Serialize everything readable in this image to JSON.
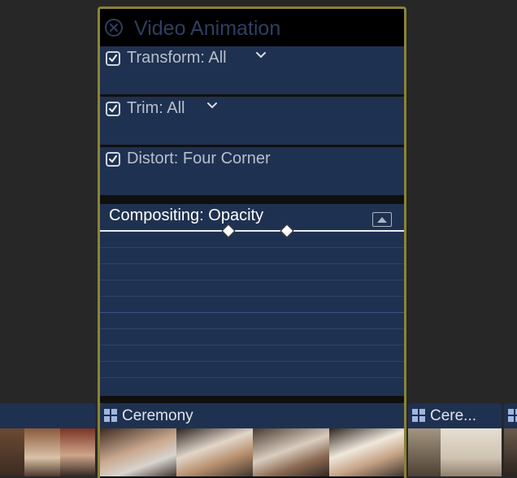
{
  "panel": {
    "title": "Video Animation",
    "rows": [
      {
        "label": "Transform: All",
        "checked": true,
        "has_menu": true
      },
      {
        "label": "Trim: All",
        "checked": true,
        "has_menu": true
      },
      {
        "label": "Distort: Four Corner",
        "checked": true,
        "has_menu": false
      }
    ],
    "compositing": {
      "label": "Compositing: Opacity"
    }
  },
  "clips": [
    {
      "title": ""
    },
    {
      "title": "Ceremony"
    },
    {
      "title": "Cere..."
    },
    {
      "title": ""
    }
  ],
  "colors": {
    "accent_border": "#8a8337",
    "row_bg": "#1f3150",
    "background": "#272727"
  }
}
